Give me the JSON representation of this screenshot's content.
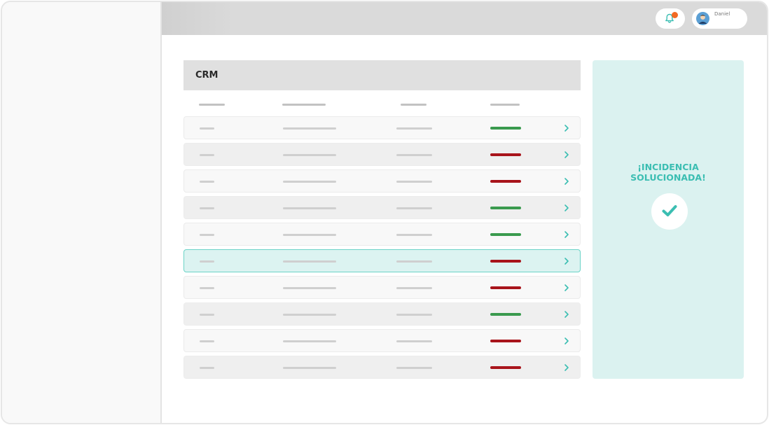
{
  "header": {
    "notification_badge": "",
    "user_name": "Daniel"
  },
  "crm": {
    "title": "CRM",
    "rows": [
      {
        "status": "green"
      },
      {
        "status": "red"
      },
      {
        "status": "red"
      },
      {
        "status": "green"
      },
      {
        "status": "green"
      },
      {
        "status": "red",
        "selected": true
      },
      {
        "status": "red"
      },
      {
        "status": "green"
      },
      {
        "status": "red"
      },
      {
        "status": "red"
      }
    ]
  },
  "incident_panel": {
    "line1": "¡INCIDENCIA",
    "line2": "SOLUCIONADA!"
  },
  "colors": {
    "green": "#3a9a4e",
    "red": "#a8141b",
    "accent": "#3bbeb2",
    "badge": "#f26a24"
  },
  "icons": [
    "bell-icon",
    "avatar-icon",
    "chevron-right-icon",
    "checkmark-icon"
  ]
}
